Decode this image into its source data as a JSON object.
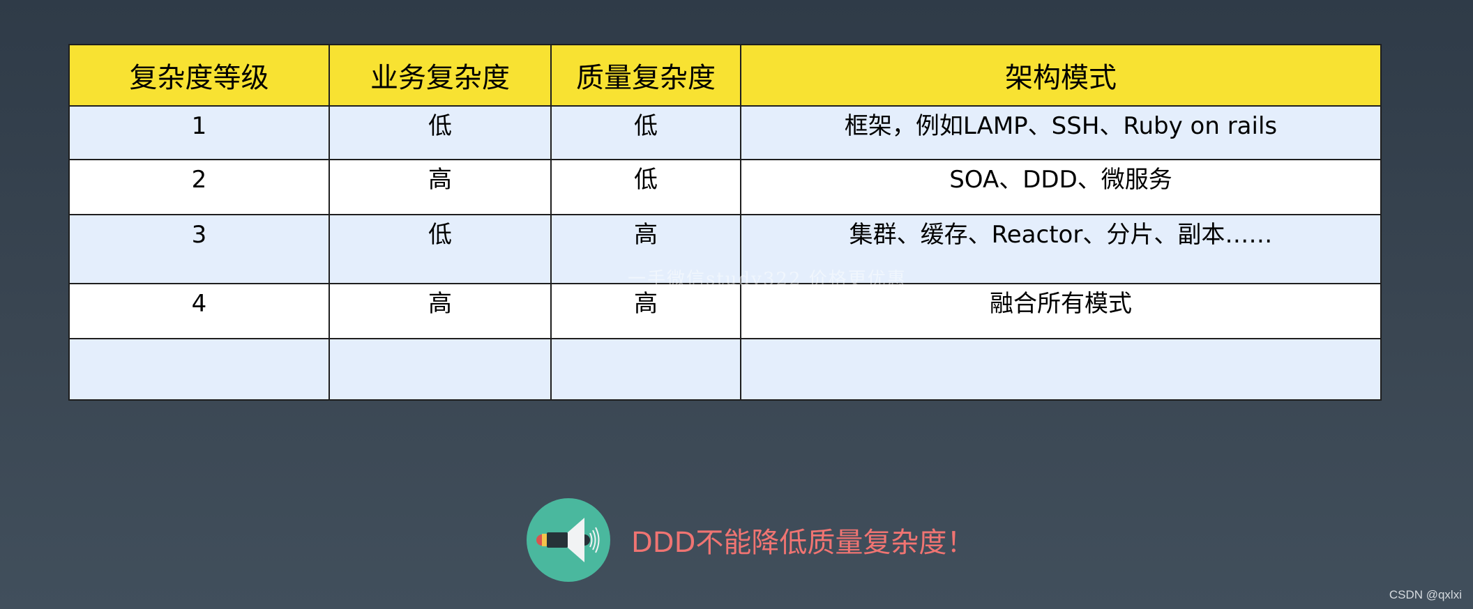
{
  "table": {
    "headers": [
      "复杂度等级",
      "业务复杂度",
      "质量复杂度",
      "架构模式"
    ],
    "rows": [
      [
        "1",
        "低",
        "低",
        "框架，例如LAMP、SSH、Ruby on rails"
      ],
      [
        "2",
        "高",
        "低",
        "SOA、DDD、微服务"
      ],
      [
        "3",
        "低",
        "高",
        "集群、缓存、Reactor、分片、副本……"
      ],
      [
        "4",
        "高",
        "高",
        "融合所有模式"
      ],
      [
        "",
        "",
        "",
        ""
      ]
    ]
  },
  "watermark": "一手微信study322 价格更优惠",
  "callout": {
    "icon": "megaphone-icon",
    "text": "DDD不能降低质量复杂度！"
  },
  "footer": {
    "credit": "CSDN @qxlxi"
  },
  "colors": {
    "header_bg": "#f8e232",
    "row_alt_bg": "#e4eefc",
    "callout_text": "#f07472",
    "icon_circle": "#4ab89e"
  }
}
